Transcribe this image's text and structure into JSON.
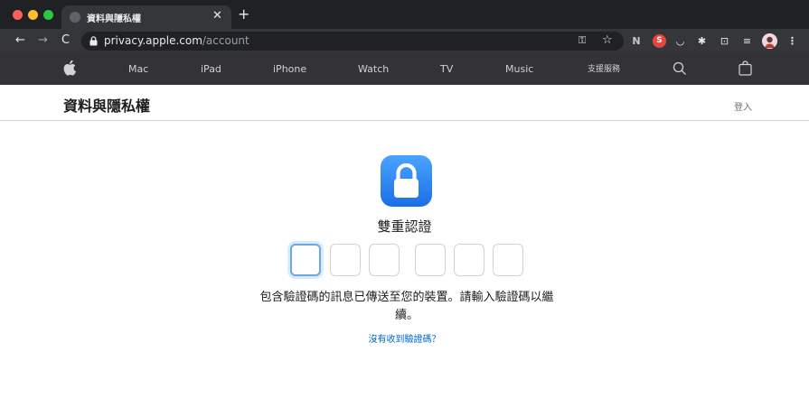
{
  "browser": {
    "tab_title": "資料與隱私權",
    "tab_close": "✕",
    "new_tab": "+",
    "url_host": "privacy.apple.com",
    "url_path": "/account",
    "extension_n": "N",
    "extension_s": "S"
  },
  "apple_nav": {
    "items": [
      "Mac",
      "iPad",
      "iPhone",
      "Watch",
      "TV",
      "Music",
      "支援服務"
    ]
  },
  "local_nav": {
    "title": "資料與隱私權",
    "sign_in": "登入"
  },
  "two_factor": {
    "title": "雙重認證",
    "code_digits": [
      "",
      "",
      "",
      "",
      "",
      ""
    ],
    "message": "包含驗證碼的訊息已傳送至您的裝置。請輸入驗證碼以繼續。",
    "resend_link": "沒有收到驗證碼？"
  },
  "colors": {
    "titlebar": "#202124",
    "toolbar": "#35363a",
    "apple_nav_bg": "#333336",
    "link": "#0066cc",
    "lock_tile": "#1b6fe6"
  }
}
